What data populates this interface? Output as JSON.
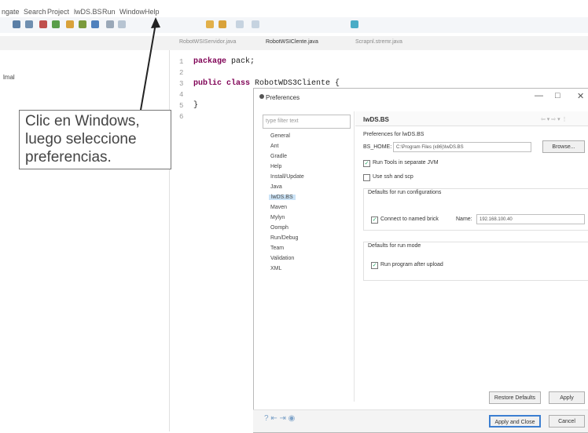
{
  "menu": [
    "ngate",
    "Search",
    "Project",
    "lwDS.BS",
    "Run",
    "Window",
    "Help"
  ],
  "editor_tabs": [
    "RobotWSIServidor.java",
    "RobotWSIClente.java",
    "Scrapnl.stremr.java"
  ],
  "explorer_item": "lmal",
  "code": {
    "line_numbers": [
      "1",
      "2",
      "3",
      "4",
      "5",
      "6"
    ],
    "package_kw": "package",
    "package_rest": " pack;",
    "class_kw": "public class",
    "class_rest": " RobotWDS3Cliente {",
    "close_brace": "}"
  },
  "annotation": {
    "line1": "Clic en Windows,",
    "line2": "luego   seleccione",
    "line3": "preferencias."
  },
  "dialog": {
    "title": "Preferences",
    "min": "—",
    "max": "□",
    "close": "✕",
    "filter_placeholder": "type filter text",
    "tree": [
      "General",
      "Ant",
      "Gradle",
      "Help",
      "Install/Update",
      "Java",
      "lwDS.BS",
      "Maven",
      "Mylyn",
      "Oomph",
      "Run/Debug",
      "Team",
      "Validation",
      "XML"
    ],
    "selected_index": 6,
    "page_title": "lwDS.BS",
    "page_nav": "⇦ ▾ ⇨ ▾ ⋮",
    "description": "Preferences for lwDS.BS",
    "home_label": "BS_HOME:",
    "home_value": "C:\\Program Files (x86)\\lwDS.BS",
    "browse": "Browse...",
    "run_tools": "Run Tools in separate JVM",
    "use_ssh": "Use ssh and scp",
    "defaults_run_config": "Defaults for run configurations",
    "connect_named": "Connect to named brick",
    "name_label": "Name:",
    "name_value": "192.168.100.40",
    "defaults_run_mode": "Defaults for run mode",
    "run_after_upload": "Run program after upload",
    "restore_defaults": "Restore Defaults",
    "apply": "Apply",
    "apply_close": "Apply and Close",
    "cancel": "Cancel",
    "footer_icons": "?  ⇤  ⇥  ◉"
  },
  "colors": {
    "selection": "#cce4f7",
    "primary_border": "#3c7fd1",
    "keyword": "#7f0055"
  }
}
